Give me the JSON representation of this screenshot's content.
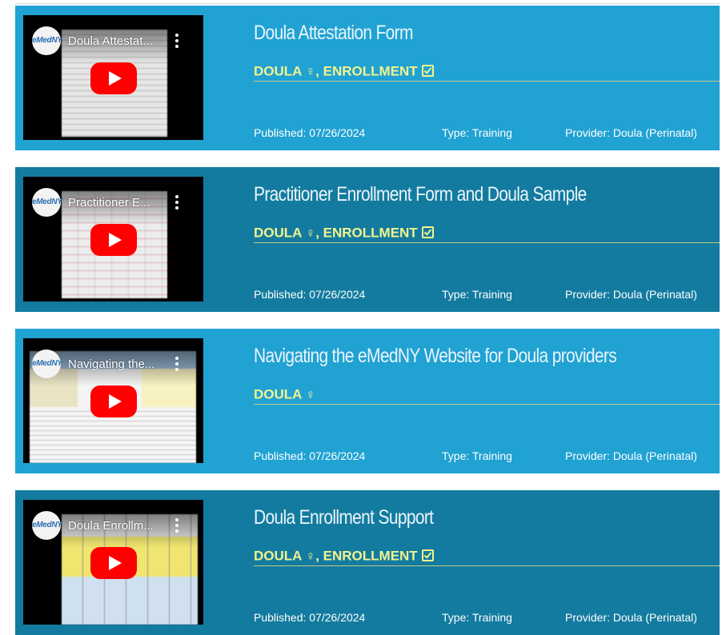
{
  "items": [
    {
      "video_channel": "eMedNY",
      "video_title": "Doula Attestat...",
      "title": "Doula Attestation Form",
      "tags": [
        {
          "label": "DOULA",
          "symbol": "♀"
        },
        {
          "label": ", ENROLLMENT",
          "symbol": "check"
        }
      ],
      "published": "Published: 07/26/2024",
      "type": "Type: Training",
      "provider": "Provider: Doula (Perinatal)"
    },
    {
      "video_channel": "eMedNY",
      "video_title": "Practitioner E...",
      "title": "Practitioner Enrollment Form and Doula Sample",
      "tags": [
        {
          "label": "DOULA",
          "symbol": "♀"
        },
        {
          "label": ", ENROLLMENT",
          "symbol": "check"
        }
      ],
      "published": "Published: 07/26/2024",
      "type": "Type: Training",
      "provider": "Provider: Doula (Perinatal)"
    },
    {
      "video_channel": "eMedNY",
      "video_title": "Navigating the...",
      "title": "Navigating the eMedNY Website for Doula providers",
      "tags": [
        {
          "label": "DOULA",
          "symbol": "♀"
        }
      ],
      "published": "Published: 07/26/2024",
      "type": "Type: Training",
      "provider": "Provider: Doula (Perinatal)"
    },
    {
      "video_channel": "eMedNY",
      "video_title": "Doula Enrollm...",
      "title": "Doula Enrollment Support",
      "tags": [
        {
          "label": "DOULA",
          "symbol": "♀"
        },
        {
          "label": ", ENROLLMENT",
          "symbol": "check"
        }
      ],
      "published": "Published: 07/26/2024",
      "type": "Type: Training",
      "provider": "Provider: Doula (Perinatal)"
    }
  ],
  "colors": {
    "card_light": "#20a2d3",
    "card_dark": "#137b9f",
    "tag_text": "#f3f38f",
    "youtube_red": "#ff0000"
  },
  "icons": {
    "female": "female-symbol-icon",
    "check": "checkbox-check-icon",
    "play": "youtube-play-icon",
    "menu": "more-vertical-icon"
  }
}
